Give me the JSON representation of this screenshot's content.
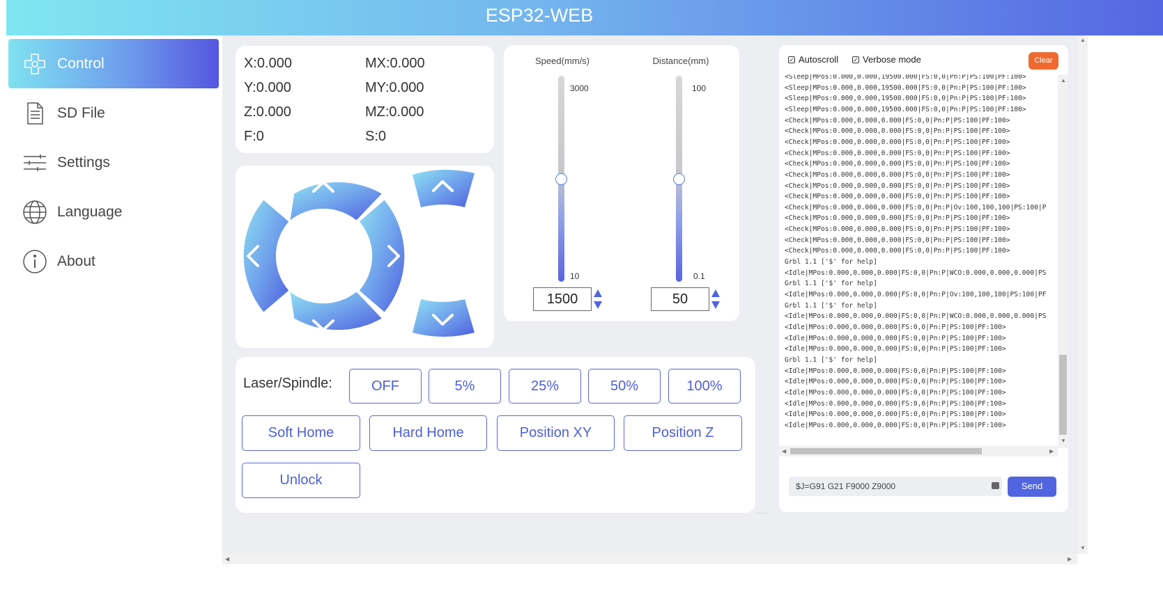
{
  "header": {
    "title": "ESP32-WEB"
  },
  "sidebar": {
    "items": [
      {
        "label": "Control",
        "icon": "gamepad-icon",
        "active": true
      },
      {
        "label": "SD File",
        "icon": "file-icon",
        "active": false
      },
      {
        "label": "Settings",
        "icon": "sliders-icon",
        "active": false
      },
      {
        "label": "Language",
        "icon": "globe-icon",
        "active": false
      },
      {
        "label": "About",
        "icon": "info-icon",
        "active": false
      }
    ]
  },
  "coords": {
    "x": "X:0.000",
    "y": "Y:0.000",
    "z": "Z:0.000",
    "f": "F:0",
    "mx": "MX:0.000",
    "my": "MY:0.000",
    "mz": "MZ:0.000",
    "s": "S:0"
  },
  "sliders": {
    "speed": {
      "title": "Speed(mm/s)",
      "max": "3000",
      "min": "10",
      "value": "1500",
      "level": 0.5
    },
    "distance": {
      "title": "Distance(mm)",
      "max": "100",
      "min": "0.1",
      "value": "50",
      "level": 0.5
    }
  },
  "laser": {
    "label": "Laser/Spindle:",
    "power_buttons": [
      "OFF",
      "5%",
      "25%",
      "50%",
      "100%"
    ],
    "actions": [
      "Soft Home",
      "Hard Home",
      "Position XY",
      "Position Z"
    ],
    "unlock": "Unlock"
  },
  "console": {
    "autoscroll": "Autoscroll",
    "verbose": "Verbose mode",
    "clear": "Clear",
    "lines": [
      "<Sleep|MPos:0.000,0.000,19500.000|FS:0,0|Pn:P|PS:100|PF:100>",
      "<Sleep|MPos:0.000,0.000,19500.000|FS:0,0|Pn:P|PS:100|PF:100>",
      "<Sleep|MPos:0.000,0.000,19500.000|FS:0,0|Pn:P|PS:100|PF:100>",
      "<Sleep|MPos:0.000,0.000,19500.000|FS:0,0|Pn:P|PS:100|PF:100>",
      "<Check|MPos:0.000,0.000,0.000|FS:0,0|Pn:P|PS:100|PF:100>",
      "<Check|MPos:0.000,0.000,0.000|FS:0,0|Pn:P|PS:100|PF:100>",
      "<Check|MPos:0.000,0.000,0.000|FS:0,0|Pn:P|PS:100|PF:100>",
      "<Check|MPos:0.000,0.000,0.000|FS:0,0|Pn:P|PS:100|PF:100>",
      "<Check|MPos:0.000,0.000,0.000|FS:0,0|Pn:P|PS:100|PF:100>",
      "<Check|MPos:0.000,0.000,0.000|FS:0,0|Pn:P|PS:100|PF:100>",
      "<Check|MPos:0.000,0.000,0.000|FS:0,0|Pn:P|PS:100|PF:100>",
      "<Check|MPos:0.000,0.000,0.000|FS:0,0|Pn:P|PS:100|PF:100>",
      "<Check|MPos:0.000,0.000,0.000|FS:0,0|Pn:P|Ov:100,100,100|PS:100|P",
      "<Check|MPos:0.000,0.000,0.000|FS:0,0|Pn:P|PS:100|PF:100>",
      "<Check|MPos:0.000,0.000,0.000|FS:0,0|Pn:P|PS:100|PF:100>",
      "<Check|MPos:0.000,0.000,0.000|FS:0,0|Pn:P|PS:100|PF:100>",
      "<Check|MPos:0.000,0.000,0.000|FS:0,0|Pn:P|PS:100|PF:100>",
      "Grbl 1.1 ['$' for help]",
      "<Idle|MPos:0.000,0.000,0.000|FS:0,0|Pn:P|WCO:0.000,0.000,0.000|PS",
      "Grbl 1.1 ['$' for help]",
      "<Idle|MPos:0.000,0.000,0.000|FS:0,0|Pn:P|Ov:100,100,100|PS:100|PF",
      "Grbl 1.1 ['$' for help]",
      "<Idle|MPos:0.000,0.000,0.000|FS:0,0|Pn:P|WCO:0.000,0.000,0.000|PS",
      "<Idle|MPos:0.000,0.000,0.000|FS:0,0|Pn:P|PS:100|PF:100>",
      "<Idle|MPos:0.000,0.000,0.000|FS:0,0|Pn:P|PS:100|PF:100>",
      "<Idle|MPos:0.000,0.000,0.000|FS:0,0|Pn:P|PS:100|PF:100>",
      "Grbl 1.1 ['$' for help]",
      "<Idle|MPos:0.000,0.000,0.000|FS:0,0|Pn:P|PS:100|PF:100>",
      "<Idle|MPos:0.000,0.000,0.000|FS:0,0|Pn:P|PS:100|PF:100>",
      "<Idle|MPos:0.000,0.000,0.000|FS:0,0|Pn:P|PS:100|PF:100>",
      "<Idle|MPos:0.000,0.000,0.000|FS:0,0|Pn:P|PS:100|PF:100>",
      "<Idle|MPos:0.000,0.000,0.000|FS:0,0|Pn:P|PS:100|PF:100>",
      "<Idle|MPos:0.000,0.000,0.000|FS:0,0|Pn:P|PS:100|PF:100>"
    ],
    "command_value": "$J=G91 G21 F9000 Z9000",
    "send": "Send"
  },
  "colors": {
    "accent": "#5165e0",
    "clear": "#f06a2f",
    "background": "#eceef2"
  }
}
